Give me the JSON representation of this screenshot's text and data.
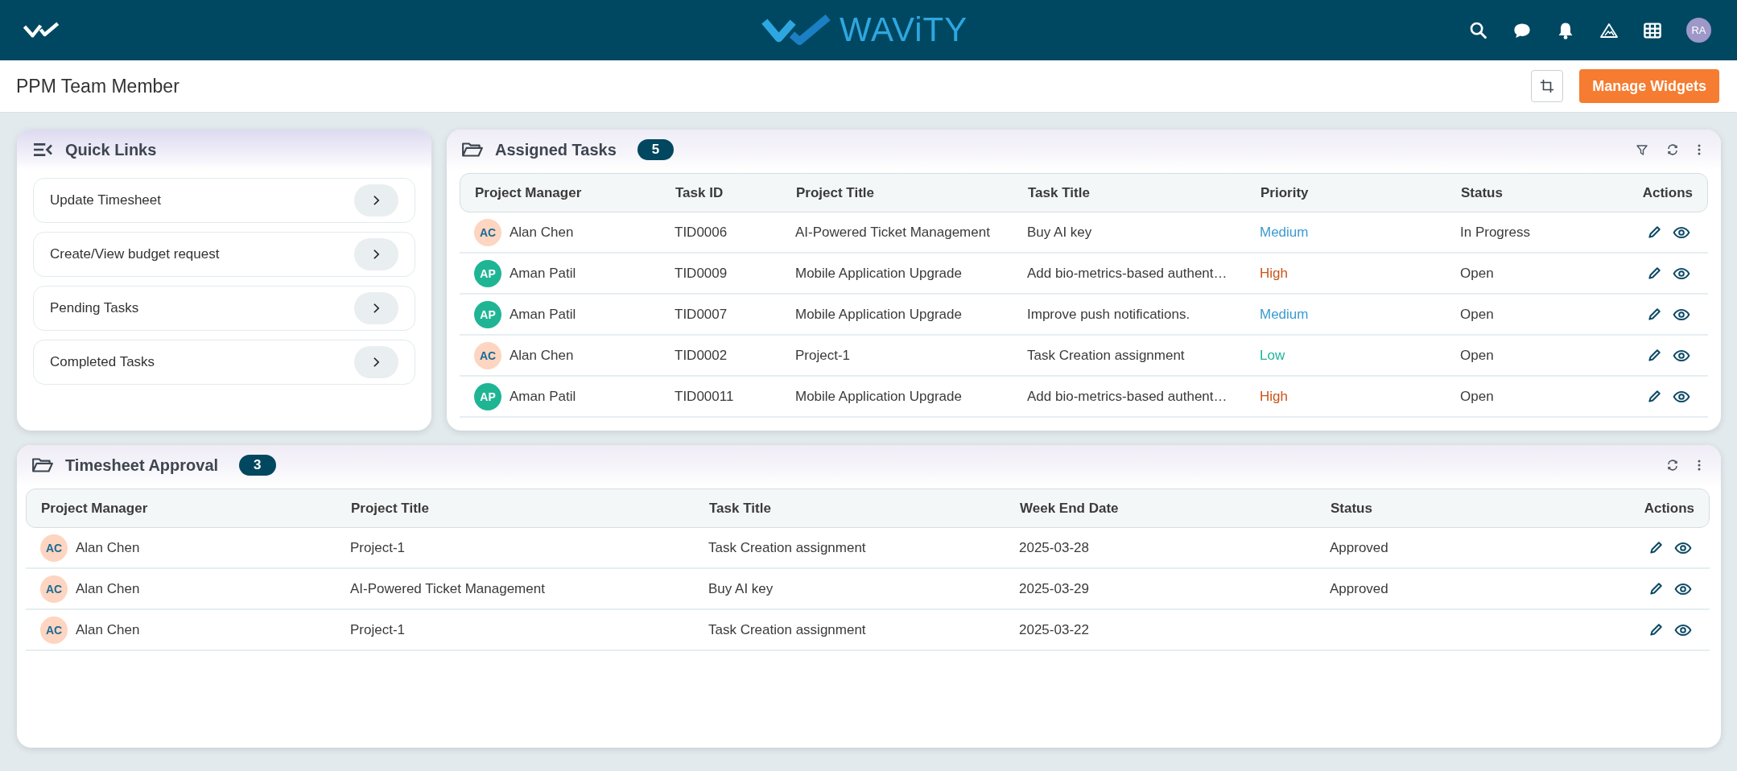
{
  "header": {
    "brand": "WAViTY",
    "user_initials": "RA"
  },
  "page": {
    "title": "PPM Team Member",
    "manage_button": "Manage Widgets"
  },
  "quick_links": {
    "title": "Quick Links",
    "items": [
      {
        "label": "Update Timesheet"
      },
      {
        "label": "Create/View budget request"
      },
      {
        "label": "Pending Tasks"
      },
      {
        "label": "Completed Tasks"
      }
    ]
  },
  "assigned_tasks": {
    "title": "Assigned Tasks",
    "count": "5",
    "columns": [
      {
        "label": "Project Manager",
        "kind": "person"
      },
      {
        "label": "Task ID",
        "kind": "text"
      },
      {
        "label": "Project Title",
        "kind": "text"
      },
      {
        "label": "Task Title",
        "kind": "text"
      },
      {
        "label": "Priority",
        "kind": "priority"
      },
      {
        "label": "Status",
        "kind": "text"
      },
      {
        "label": "Actions",
        "kind": "actions"
      }
    ],
    "rows": [
      {
        "cells": [
          {
            "initials": "AC",
            "name": "Alan Chen",
            "color": "#fdd5c0"
          },
          "TID0006",
          "AI-Powered Ticket Management",
          "Buy AI key",
          {
            "text": "Medium",
            "color": "#3a9bd0"
          },
          "In Progress"
        ]
      },
      {
        "cells": [
          {
            "initials": "AP",
            "name": "Aman Patil",
            "color": "#1fb594"
          },
          "TID0009",
          "Mobile Application Upgrade",
          "Add bio-metrics-based authent…",
          {
            "text": "High",
            "color": "#c9541a"
          },
          "Open"
        ]
      },
      {
        "cells": [
          {
            "initials": "AP",
            "name": "Aman Patil",
            "color": "#1fb594"
          },
          "TID0007",
          "Mobile Application Upgrade",
          "Improve push notifications.",
          {
            "text": "Medium",
            "color": "#3a9bd0"
          },
          "Open"
        ]
      },
      {
        "cells": [
          {
            "initials": "AC",
            "name": "Alan Chen",
            "color": "#fdd5c0"
          },
          "TID0002",
          "Project-1",
          "Task Creation assignment",
          {
            "text": "Low",
            "color": "#1fb59a"
          },
          "Open"
        ]
      },
      {
        "cells": [
          {
            "initials": "AP",
            "name": "Aman Patil",
            "color": "#1fb594"
          },
          "TID00011",
          "Mobile Application Upgrade",
          "Add bio-metrics-based authent…",
          {
            "text": "High",
            "color": "#c9541a"
          },
          "Open"
        ]
      }
    ]
  },
  "timesheet_approval": {
    "title": "Timesheet Approval",
    "count": "3",
    "columns": [
      {
        "label": "Project Manager",
        "kind": "person"
      },
      {
        "label": "Project Title",
        "kind": "text"
      },
      {
        "label": "Task Title",
        "kind": "text"
      },
      {
        "label": "Week End Date",
        "kind": "text"
      },
      {
        "label": "Status",
        "kind": "text"
      },
      {
        "label": "Actions",
        "kind": "actions"
      }
    ],
    "rows": [
      {
        "cells": [
          {
            "initials": "AC",
            "name": "Alan Chen",
            "color": "#fdd5c0"
          },
          "Project-1",
          "Task Creation assignment",
          "2025-03-28",
          "Approved"
        ]
      },
      {
        "cells": [
          {
            "initials": "AC",
            "name": "Alan Chen",
            "color": "#fdd5c0"
          },
          "AI-Powered Ticket Management",
          "Buy AI key",
          "2025-03-29",
          "Approved"
        ]
      },
      {
        "cells": [
          {
            "initials": "AC",
            "name": "Alan Chen",
            "color": "#fdd5c0"
          },
          "Project-1",
          "Task Creation assignment",
          "2025-03-22"
        ]
      }
    ]
  }
}
